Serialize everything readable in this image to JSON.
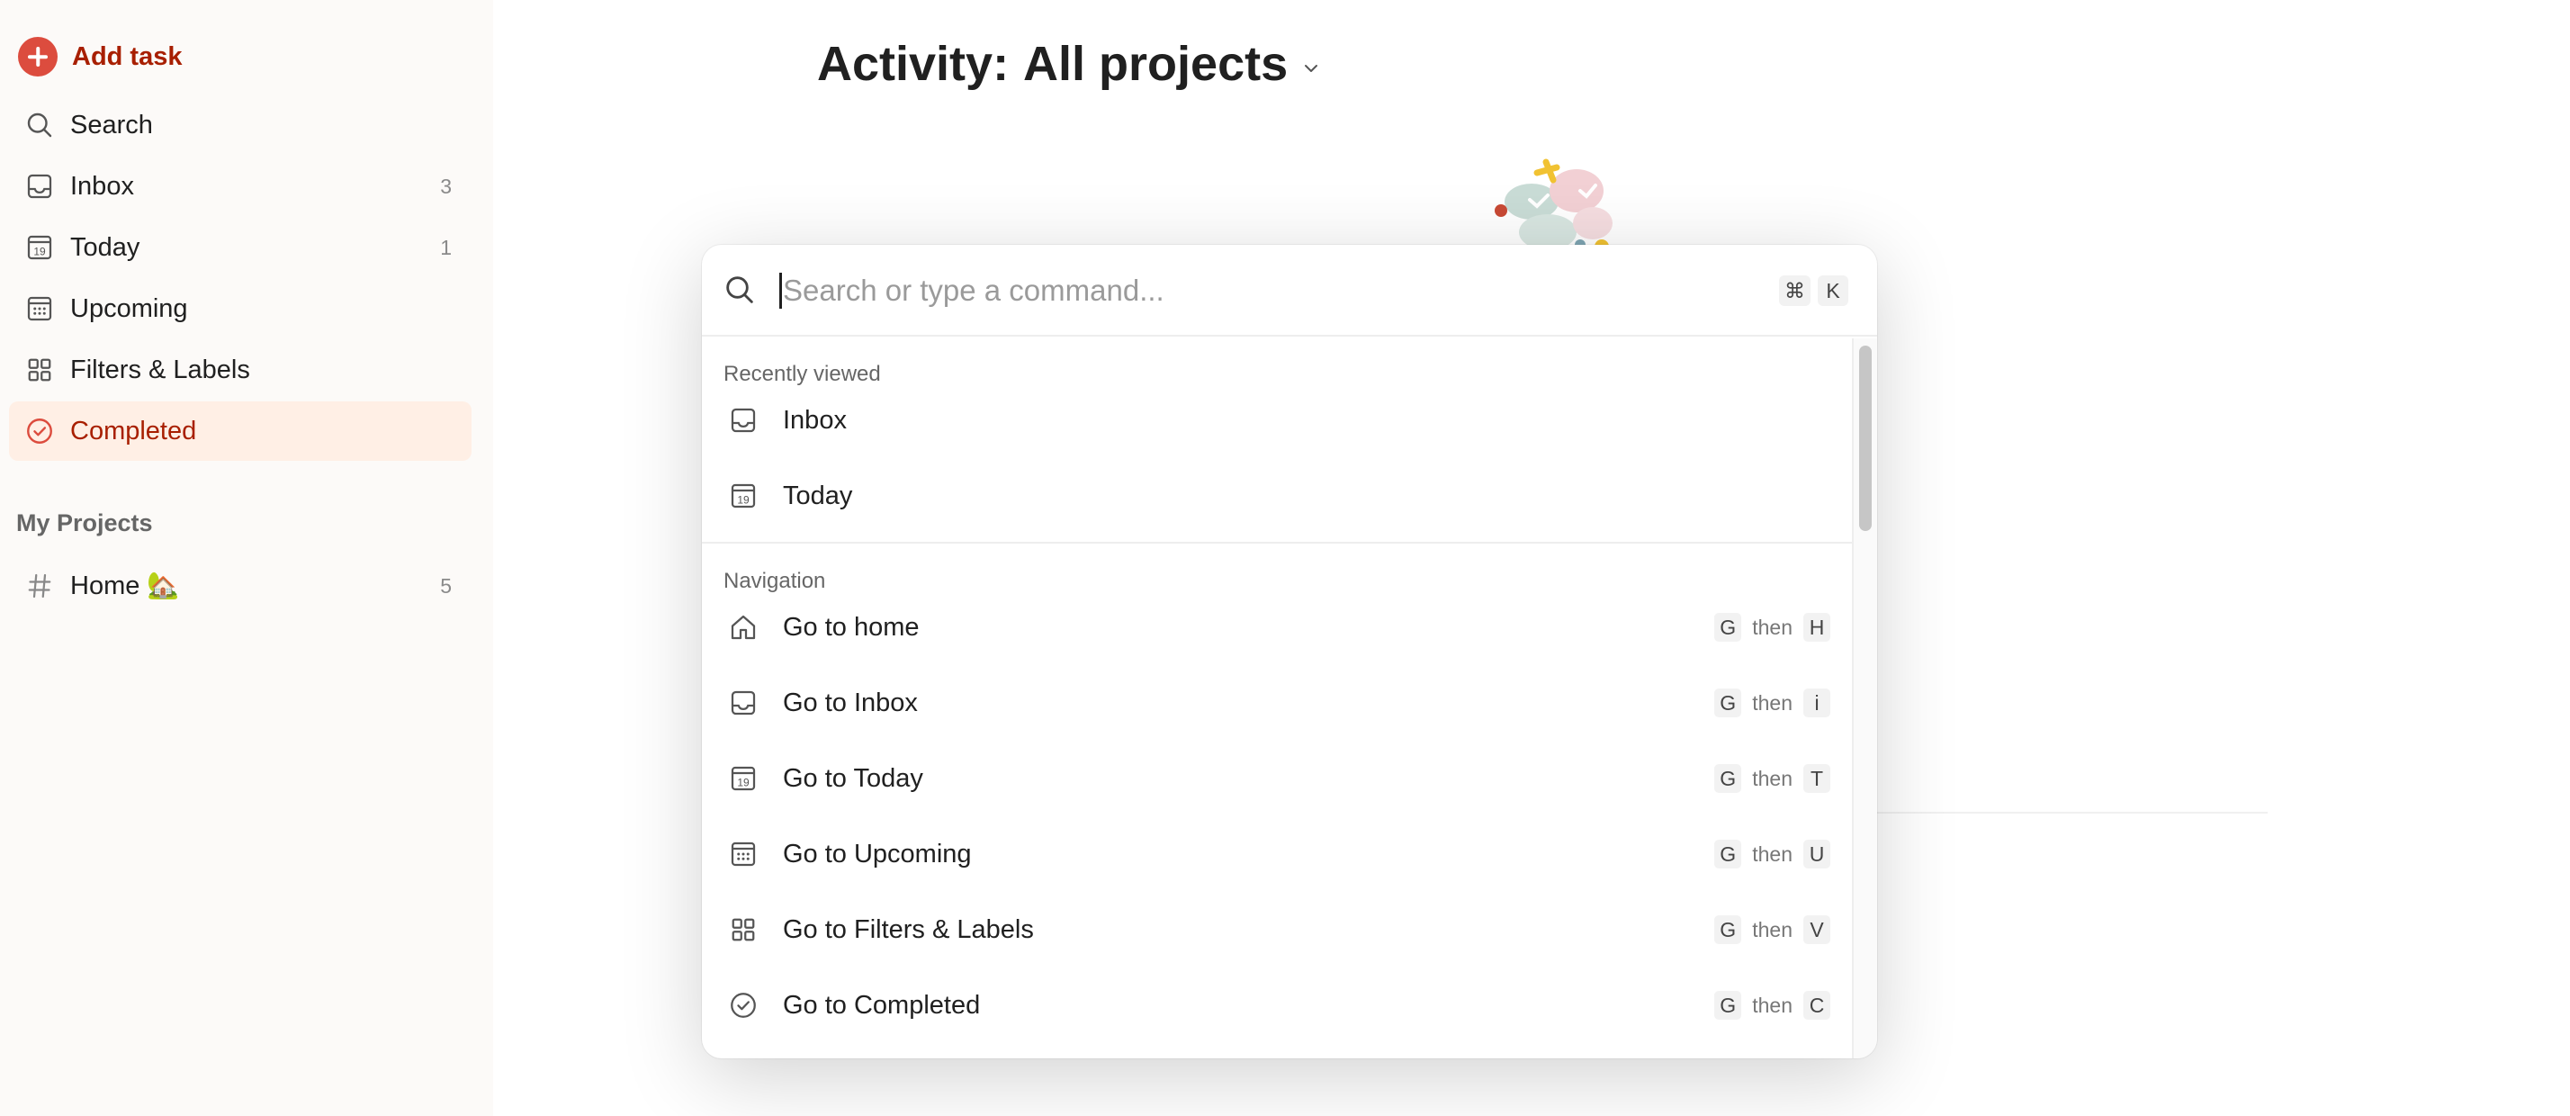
{
  "sidebar": {
    "add_task_label": "Add task",
    "items": [
      {
        "label": "Search",
        "count": ""
      },
      {
        "label": "Inbox",
        "count": "3"
      },
      {
        "label": "Today",
        "count": "1"
      },
      {
        "label": "Upcoming",
        "count": ""
      },
      {
        "label": "Filters & Labels",
        "count": ""
      },
      {
        "label": "Completed",
        "count": ""
      }
    ],
    "today_icon_number": "19",
    "projects_title": "My Projects",
    "projects": [
      {
        "label": "Home 🏡",
        "count": "5"
      }
    ]
  },
  "main": {
    "title_prefix": "Activity:",
    "title_value": "All projects"
  },
  "palette": {
    "search_placeholder": "Search or type a command...",
    "hotkey": [
      "⌘",
      "K"
    ],
    "recent_label": "Recently viewed",
    "recent": [
      {
        "label": "Inbox",
        "icon": "inbox-icon"
      },
      {
        "label": "Today",
        "icon": "calendar-today-icon"
      }
    ],
    "navigation_label": "Navigation",
    "then_word": "then",
    "navigation": [
      {
        "label": "Go to home",
        "icon": "home-icon",
        "keys": [
          "G",
          "H"
        ]
      },
      {
        "label": "Go to Inbox",
        "icon": "inbox-icon",
        "keys": [
          "G",
          "i"
        ]
      },
      {
        "label": "Go to Today",
        "icon": "calendar-today-icon",
        "keys": [
          "G",
          "T"
        ]
      },
      {
        "label": "Go to Upcoming",
        "icon": "calendar-grid-icon",
        "keys": [
          "G",
          "U"
        ]
      },
      {
        "label": "Go to Filters & Labels",
        "icon": "filters-grid-icon",
        "keys": [
          "G",
          "V"
        ]
      },
      {
        "label": "Go to Completed",
        "icon": "check-circle-icon",
        "keys": [
          "G",
          "C"
        ]
      }
    ]
  },
  "colors": {
    "accent": "#dc4c3e",
    "accent_text": "#a81f00",
    "active_bg": "#ffefe5",
    "sidebar_bg": "#fcfaf8"
  }
}
